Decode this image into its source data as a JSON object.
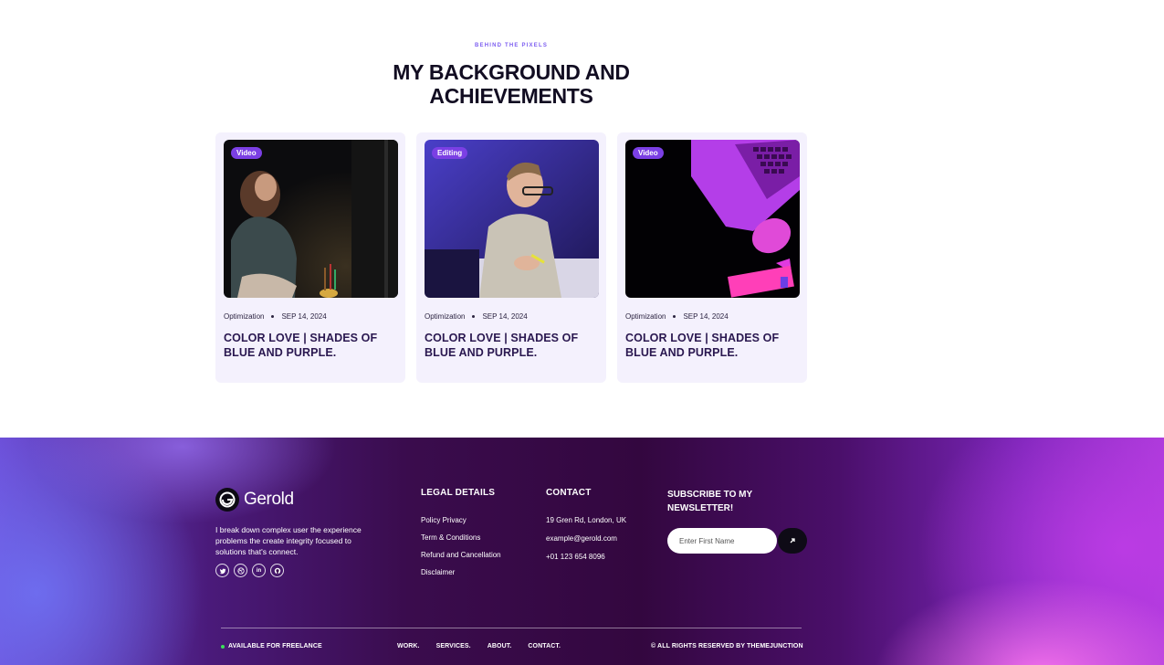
{
  "section": {
    "eyebrow": "BEHIND THE PIXELS",
    "heading_line1": "MY BACKGROUND AND",
    "heading_line2": "ACHIEVEMENTS"
  },
  "cards": [
    {
      "tag": "Video",
      "category": "Optimization",
      "date": "SEP 14, 2024",
      "title": "COLOR LOVE | SHADES OF BLUE AND PURPLE."
    },
    {
      "tag": "Editing",
      "category": "Optimization",
      "date": "SEP 14, 2024",
      "title": "COLOR LOVE | SHADES OF BLUE AND PURPLE."
    },
    {
      "tag": "Video",
      "category": "Optimization",
      "date": "SEP 14, 2024",
      "title": "COLOR LOVE | SHADES OF BLUE AND PURPLE."
    }
  ],
  "footer": {
    "brand": "Gerold",
    "about": "I break down complex user the experience problems the create integrity focused to solutions that's connect.",
    "socials": [
      "twitter-icon",
      "dribbble-icon",
      "linkedin-icon",
      "github-icon"
    ],
    "legal": {
      "title": "LEGAL DETAILS",
      "items": [
        "Policy Privacy",
        "Term & Conditions",
        "Refund and Cancellation",
        "Disclaimer"
      ]
    },
    "contact": {
      "title": "CONTACT",
      "items": [
        "19 Gren Rd, London, UK",
        "example@gerold.com",
        "+01 123 654 8096"
      ]
    },
    "newsletter": {
      "title": "SUBSCRIBE TO MY NEWSLETTER!",
      "placeholder": "Enter First Name"
    },
    "available": "AVAILABLE FOR FREELANCE",
    "nav": [
      "WORK.",
      "SERVICES.",
      "ABOUT.",
      "CONTACT."
    ],
    "copyright": "© ALL RIGHTS RESERVED BY THEMEJUNCTION"
  },
  "colors": {
    "accent": "#7b3fe4",
    "card_bg": "#f4f1fd",
    "available_dot": "#3be35b"
  }
}
